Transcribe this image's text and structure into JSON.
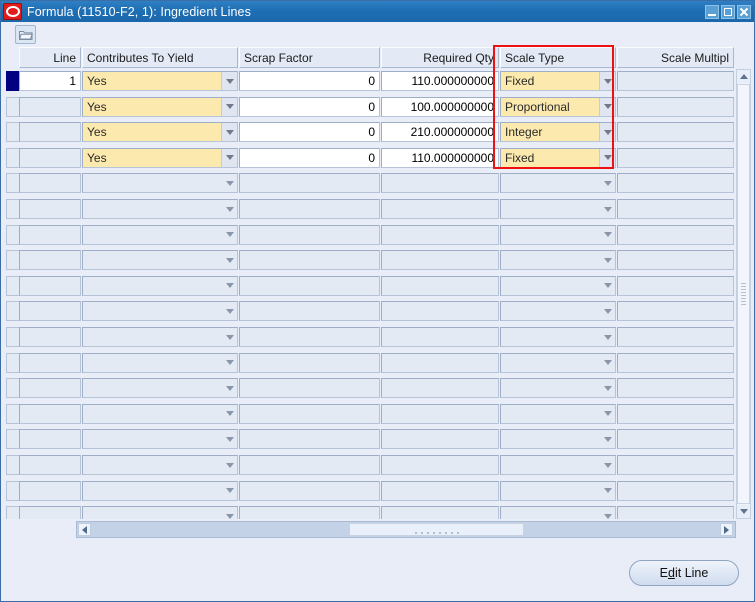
{
  "window": {
    "title": "Formula (11510-F2, 1): Ingredient Lines",
    "logo_icon": "oracle-logo-icon",
    "controls": {
      "minimize": "minimize-icon",
      "maximize": "maximize-icon",
      "close": "close-icon"
    }
  },
  "toolbar": {
    "open_icon": "folder-open-icon"
  },
  "grid": {
    "columns": [
      {
        "key": "line",
        "label": "Line",
        "align": "right"
      },
      {
        "key": "contributes_to_yield",
        "label": "Contributes To Yield",
        "align": "left"
      },
      {
        "key": "scrap_factor",
        "label": "Scrap Factor",
        "align": "left"
      },
      {
        "key": "required_qty",
        "label": "Required Qty",
        "align": "right"
      },
      {
        "key": "scale_type",
        "label": "Scale Type",
        "align": "left"
      },
      {
        "key": "scale_multiplier",
        "label": "Scale Multipl",
        "align": "right"
      }
    ],
    "rows": [
      {
        "selected": true,
        "line": "1",
        "contributes_to_yield": "Yes",
        "scrap_factor": "0",
        "required_qty": "110.000000000",
        "scale_type": "Fixed",
        "scale_multiplier": ""
      },
      {
        "selected": false,
        "line": "",
        "contributes_to_yield": "Yes",
        "scrap_factor": "0",
        "required_qty": "100.000000000",
        "scale_type": "Proportional",
        "scale_multiplier": ""
      },
      {
        "selected": false,
        "line": "",
        "contributes_to_yield": "Yes",
        "scrap_factor": "0",
        "required_qty": "210.000000000",
        "scale_type": "Integer",
        "scale_multiplier": ""
      },
      {
        "selected": false,
        "line": "",
        "contributes_to_yield": "Yes",
        "scrap_factor": "0",
        "required_qty": "110.000000000",
        "scale_type": "Fixed",
        "scale_multiplier": ""
      }
    ],
    "empty_row_count": 14
  },
  "scrollbars": {
    "vertical": {
      "up_icon": "scroll-up-icon",
      "down_icon": "scroll-down-icon"
    },
    "horizontal": {
      "left_icon": "scroll-left-icon",
      "right_icon": "scroll-right-icon"
    }
  },
  "footer": {
    "edit_line_label_before": "E",
    "edit_line_mnemonic": "d",
    "edit_line_label_after": "it Line"
  },
  "annotation": {
    "color": "#ee1111",
    "target_column": "Scale Type"
  },
  "colors": {
    "titlebar": "#1f6fb4",
    "lov_field": "#fce9ae",
    "selected_record": "#000080",
    "panel": "#e8edf7"
  }
}
